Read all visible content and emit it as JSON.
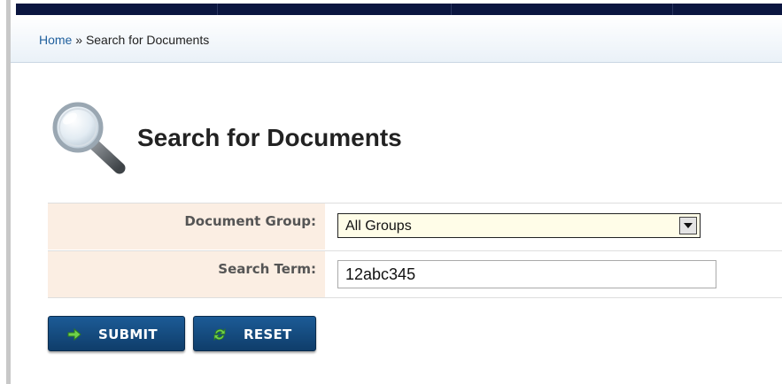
{
  "breadcrumb": {
    "home": "Home",
    "separator": " » ",
    "current": "Search for Documents"
  },
  "page": {
    "title": "Search for Documents",
    "icon": "magnifier-icon"
  },
  "form": {
    "document_group": {
      "label": "Document Group:",
      "selected": "All Groups"
    },
    "search_term": {
      "label": "Search Term:",
      "value": "12abc345"
    }
  },
  "buttons": {
    "submit": {
      "label": "SUBMIT",
      "icon": "arrow-right-icon"
    },
    "reset": {
      "label": "RESET",
      "icon": "refresh-icon"
    }
  },
  "colors": {
    "topbar": "#0b1640",
    "label_bg": "#fbeee3",
    "button": "#1c5b96",
    "select_bg": "#fffde8",
    "link": "#1f5f9d"
  }
}
